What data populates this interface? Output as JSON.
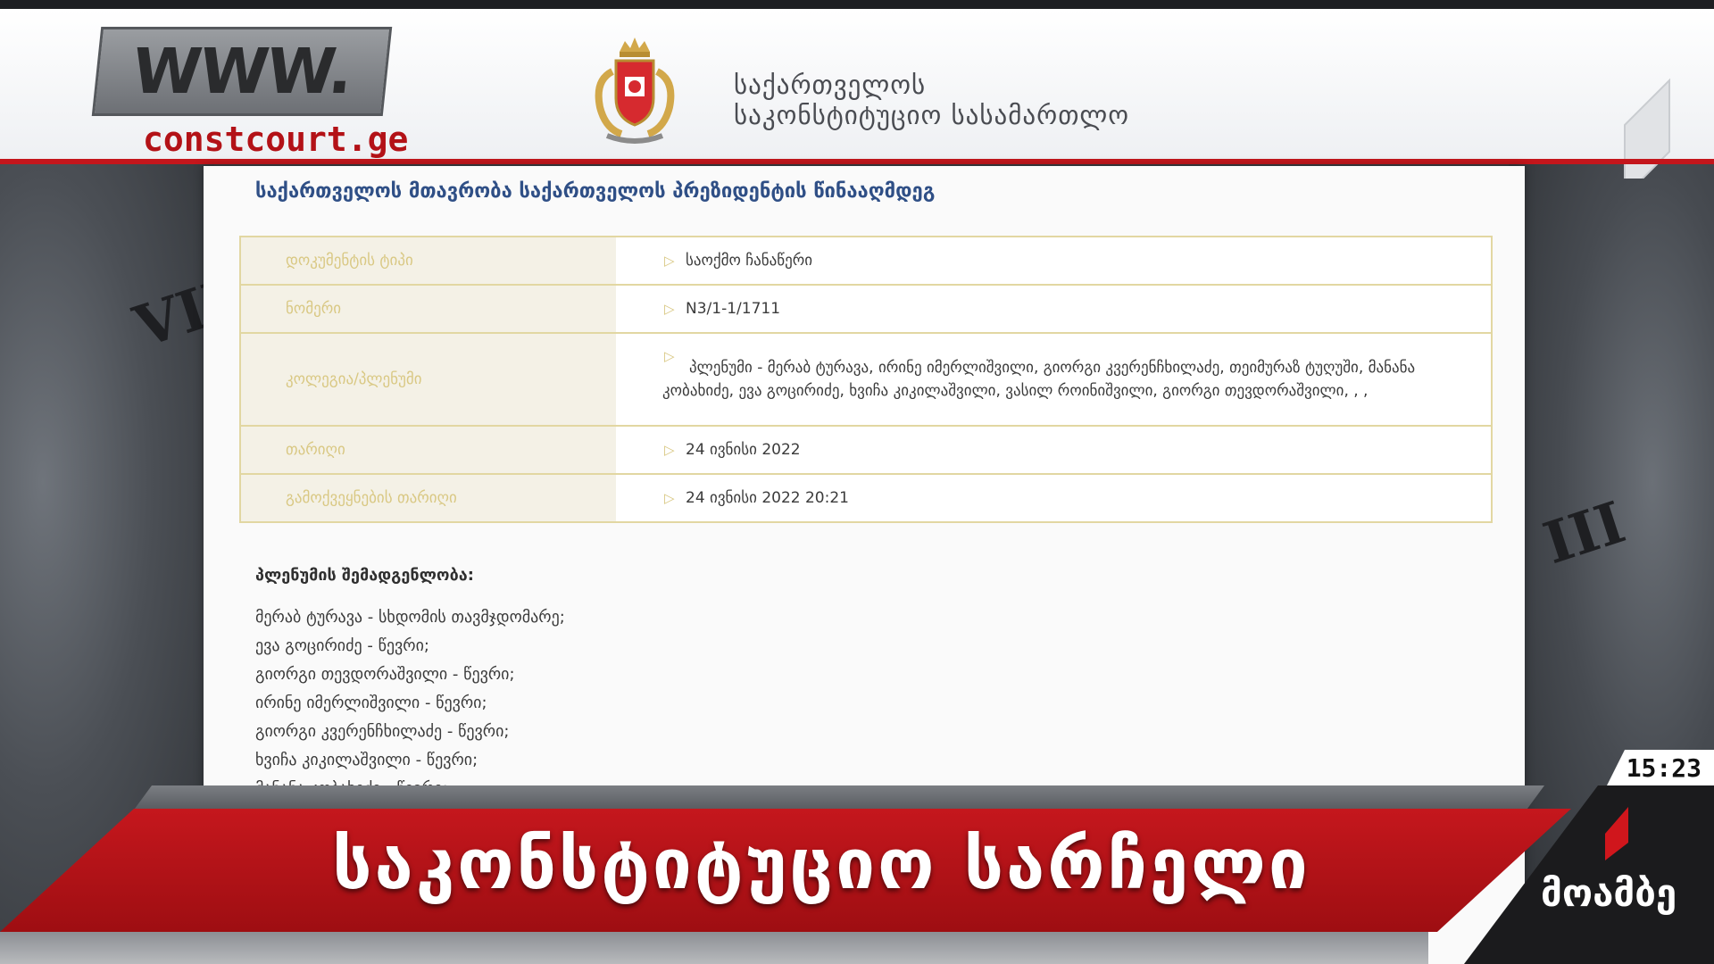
{
  "header": {
    "www_text": "WWW.",
    "domain": "constcourt.ge",
    "court_name_line1": "საქართველოს",
    "court_name_line2": "საკონსტიტუციო სასამართლო"
  },
  "document": {
    "title": "საქართველოს მთავრობა საქართველოს პრეზიდენტის წინააღმდეგ",
    "rows": [
      {
        "label": "დოკუმენტის ტიპი",
        "value": "საოქმო ჩანაწერი"
      },
      {
        "label": "ნომერი",
        "value": "N3/1-1/1711"
      },
      {
        "label": "კოლეგია/პლენუმი",
        "value": "პლენუმი - მერაბ ტურავა, ირინე იმერლიშვილი, გიორგი კვერენჩხილაძე, თეიმურაზ ტუღუში, მანანა კობახიძე, ევა გოცირიძე, ხვიჩა კიკილაშვილი, ვასილ როინიშვილი, გიორგი თევდორაშვილი, , ,"
      },
      {
        "label": "თარიღი",
        "value": "24 ივნისი 2022"
      },
      {
        "label": "გამოქვეყნების თარიღი",
        "value": "24 ივნისი 2022 20:21"
      }
    ],
    "plenum_heading": "პლენუმის შემადგენლობა:",
    "plenum_members": [
      "მერაბ ტურავა - სხდომის თავმჯდომარე;",
      "ევა გოცირიძე - წევრი;",
      "გიორგი თევდორაშვილი - წევრი;",
      "ირინე იმერლიშვილი - წევრი;",
      "გიორგი კვერენჩხილაძე - წევრი;",
      "ხვიჩა კიკილაშვილი - წევრი;",
      "მანანა კობახიძე - წევრი;"
    ]
  },
  "lower_third": {
    "headline": "საკონსტიტუციო სარჩელი",
    "time": "15:23",
    "channel": "მოამბე"
  },
  "colors": {
    "brand_red": "#c4161c",
    "title_blue": "#2f4f86",
    "table_border": "#e2d7a2"
  }
}
